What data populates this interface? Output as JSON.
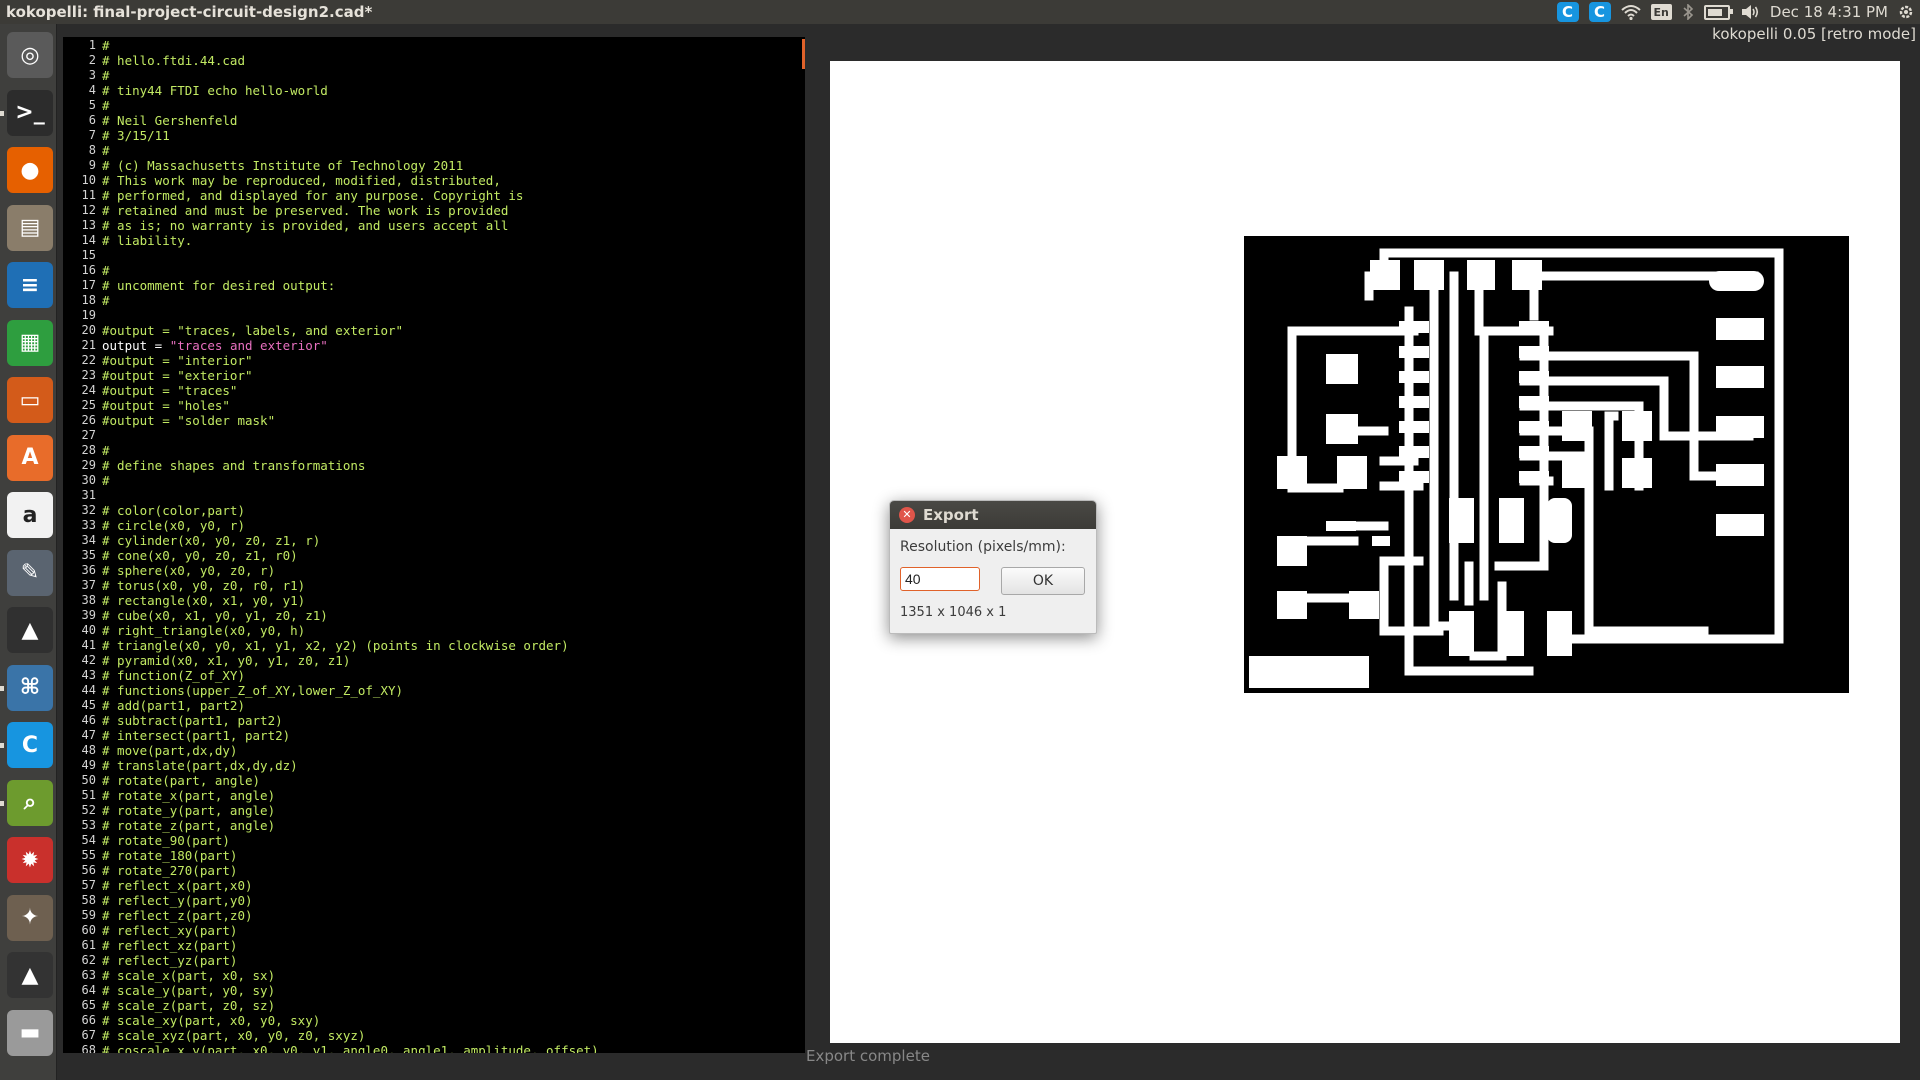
{
  "window": {
    "title": "kokopelli:  final-project-circuit-design2.cad*",
    "version_label": "kokopelli 0.05 [retro mode]"
  },
  "panel": {
    "indicators": [
      "c-app-icon",
      "c-app-icon",
      "wifi-icon",
      "keyboard-layout",
      "bluetooth-icon",
      "battery-icon",
      "volume-icon"
    ],
    "keyboard": "En",
    "datetime": "Dec 18  4:31 PM"
  },
  "launcher": {
    "items": [
      {
        "name": "ubuntu-dash-icon",
        "color": "#5a5a5a"
      },
      {
        "name": "terminal-icon",
        "color": "#2c2c2c"
      },
      {
        "name": "firefox-icon",
        "color": "#e66000"
      },
      {
        "name": "files-icon",
        "color": "#8a7d6a"
      },
      {
        "name": "writer-icon",
        "color": "#1f6fb5"
      },
      {
        "name": "calc-icon",
        "color": "#2e9e3f"
      },
      {
        "name": "impress-icon",
        "color": "#d35b1a"
      },
      {
        "name": "software-center-icon",
        "color": "#e86c2a"
      },
      {
        "name": "amazon-icon",
        "color": "#f2f2f2"
      },
      {
        "name": "settings-icon",
        "color": "#5a6470"
      },
      {
        "name": "inkscape-icon",
        "color": "#303030"
      },
      {
        "name": "python-icon",
        "color": "#3a74a8"
      },
      {
        "name": "c-app-icon",
        "color": "#1795e0"
      },
      {
        "name": "image-viewer-icon",
        "color": "#6d9b2e"
      },
      {
        "name": "system-settings-icon",
        "color": "#c9302c"
      },
      {
        "name": "gimp-icon",
        "color": "#6e6050"
      },
      {
        "name": "inkscape-icon",
        "color": "#333333"
      },
      {
        "name": "scanner-icon",
        "color": "#9a9a9a"
      }
    ]
  },
  "editor": {
    "active_line": 21,
    "lines": [
      "#",
      "# hello.ftdi.44.cad",
      "#",
      "# tiny44 FTDI echo hello-world",
      "#",
      "# Neil Gershenfeld",
      "# 3/15/11",
      "#",
      "# (c) Massachusetts Institute of Technology 2011",
      "# This work may be reproduced, modified, distributed,",
      "# performed, and displayed for any purpose. Copyright is",
      "# retained and must be preserved. The work is provided",
      "# as is; no warranty is provided, and users accept all",
      "# liability.",
      "",
      "#",
      "# uncomment for desired output:",
      "#",
      "",
      "#output = \"traces, labels, and exterior\"",
      "output = \"traces and exterior\"",
      "#output = \"interior\"",
      "#output = \"exterior\"",
      "#output = \"traces\"",
      "#output = \"holes\"",
      "#output = \"solder mask\"",
      "",
      "#",
      "# define shapes and transformations",
      "#",
      "",
      "# color(color,part)",
      "# circle(x0, y0, r)",
      "# cylinder(x0, y0, z0, z1, r)",
      "# cone(x0, y0, z0, z1, r0)",
      "# sphere(x0, y0, z0, r)",
      "# torus(x0, y0, z0, r0, r1)",
      "# rectangle(x0, x1, y0, y1)",
      "# cube(x0, x1, y0, y1, z0, z1)",
      "# right_triangle(x0, y0, h)",
      "# triangle(x0, y0, x1, y1, x2, y2) (points in clockwise order)",
      "# pyramid(x0, x1, y0, y1, z0, z1)",
      "# function(Z_of_XY)",
      "# functions(upper_Z_of_XY,lower_Z_of_XY)",
      "# add(part1, part2)",
      "# subtract(part1, part2)",
      "# intersect(part1, part2)",
      "# move(part,dx,dy)",
      "# translate(part,dx,dy,dz)",
      "# rotate(part, angle)",
      "# rotate_x(part, angle)",
      "# rotate_y(part, angle)",
      "# rotate_z(part, angle)",
      "# rotate_90(part)",
      "# rotate_180(part)",
      "# rotate_270(part)",
      "# reflect_x(part,x0)",
      "# reflect_y(part,y0)",
      "# reflect_z(part,z0)",
      "# reflect_xy(part)",
      "# reflect_xz(part)",
      "# reflect_yz(part)",
      "# scale_x(part, x0, sx)",
      "# scale_y(part, y0, sy)",
      "# scale_z(part, z0, sz)",
      "# scale_xy(part, x0, y0, sxy)",
      "# scale_xyz(part, x0, y0, z0, sxyz)",
      "# coscale_x_y(part, x0, y0, y1, angle0, angle1, amplitude, offset)"
    ]
  },
  "dialog": {
    "title": "Export",
    "resolution_label": "Resolution (pixels/mm):",
    "resolution_value": "40",
    "ok_label": "OK",
    "dimensions": "1351 x 1046 x 1"
  },
  "status": {
    "message": "Export complete"
  },
  "colors": {
    "code_green": "#c2ea63",
    "string_pink": "#e870c0",
    "accent_orange": "#e0622a",
    "panel_bg": "#3c3b37"
  }
}
